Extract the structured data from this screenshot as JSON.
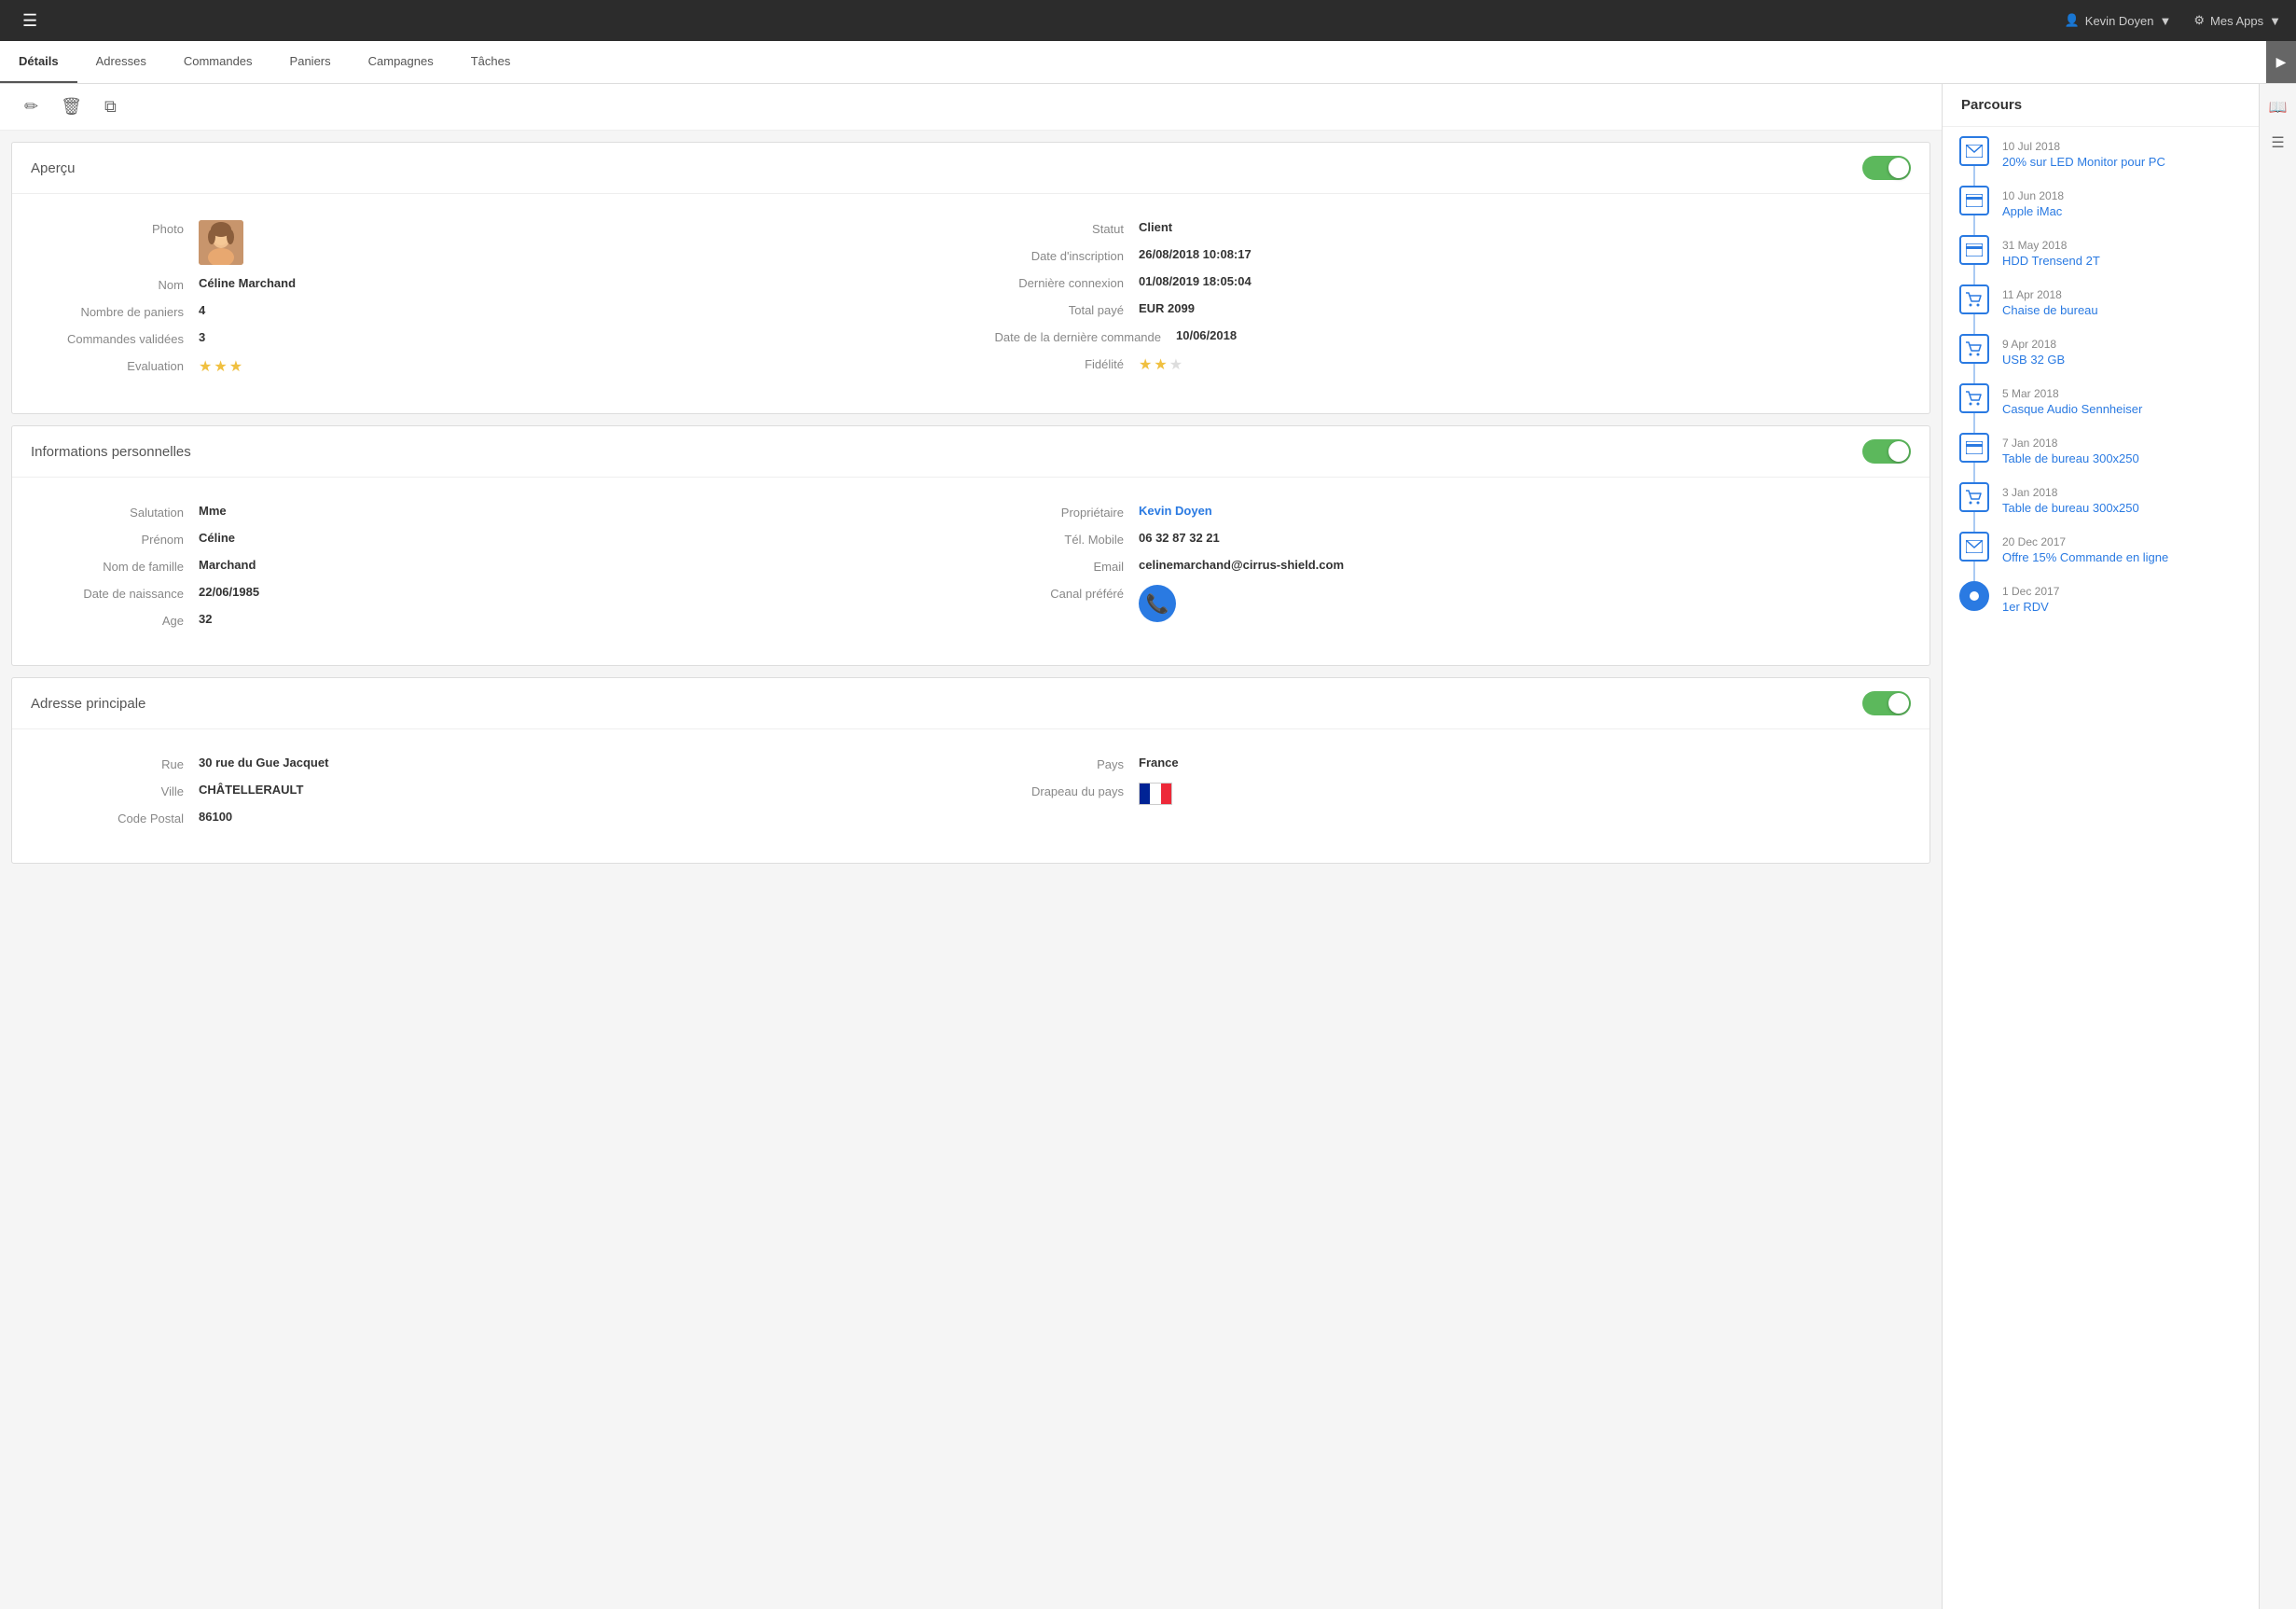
{
  "header": {
    "hamburger_label": "☰",
    "user_icon": "👤",
    "user_name": "Kevin Doyen",
    "user_chevron": "▼",
    "apps_icon": "⚙",
    "apps_label": "Mes Apps",
    "apps_chevron": "▼"
  },
  "tabs": {
    "items": [
      {
        "label": "Détails",
        "active": true
      },
      {
        "label": "Adresses",
        "active": false
      },
      {
        "label": "Commandes",
        "active": false
      },
      {
        "label": "Paniers",
        "active": false
      },
      {
        "label": "Campagnes",
        "active": false
      },
      {
        "label": "Tâches",
        "active": false
      }
    ],
    "arrow": "▶"
  },
  "toolbar": {
    "edit_icon": "✏",
    "delete_icon": "🗑",
    "copy_icon": "⧉"
  },
  "apercu": {
    "title": "Aperçu",
    "fields_left": {
      "photo_label": "Photo",
      "nom_label": "Nom",
      "nom_value": "Céline Marchand",
      "paniers_label": "Nombre de paniers",
      "paniers_value": "4",
      "commandes_label": "Commandes validées",
      "commandes_value": "3",
      "evaluation_label": "Evaluation"
    },
    "fields_right": {
      "statut_label": "Statut",
      "statut_value": "Client",
      "inscription_label": "Date d'inscription",
      "inscription_value": "26/08/2018 10:08:17",
      "connexion_label": "Dernière connexion",
      "connexion_value": "01/08/2019 18:05:04",
      "total_label": "Total payé",
      "total_value": "EUR 2099",
      "date_commande_label": "Date de la dernière commande",
      "date_commande_value": "10/06/2018",
      "fidelite_label": "Fidélité"
    }
  },
  "infos_perso": {
    "title": "Informations personnelles",
    "fields_left": {
      "salutation_label": "Salutation",
      "salutation_value": "Mme",
      "prenom_label": "Prénom",
      "prenom_value": "Céline",
      "nom_label": "Nom de famille",
      "nom_value": "Marchand",
      "naissance_label": "Date de naissance",
      "naissance_value": "22/06/1985",
      "age_label": "Age",
      "age_value": "32"
    },
    "fields_right": {
      "proprietaire_label": "Propriétaire",
      "proprietaire_value": "Kevin Doyen",
      "mobile_label": "Tél. Mobile",
      "mobile_value": "06 32 87 32 21",
      "email_label": "Email",
      "email_value": "celinemarchand@cirrus-shield.com",
      "canal_label": "Canal préféré"
    }
  },
  "adresse": {
    "title": "Adresse principale",
    "fields_left": {
      "rue_label": "Rue",
      "rue_value": "30 rue du Gue Jacquet",
      "ville_label": "Ville",
      "ville_value": "CHÂTELLERAULT",
      "code_label": "Code Postal",
      "code_value": "86100"
    },
    "fields_right": {
      "pays_label": "Pays",
      "pays_value": "France",
      "drapeau_label": "Drapeau du pays"
    }
  },
  "parcours": {
    "title": "Parcours",
    "items": [
      {
        "date": "10 Jul 2018",
        "label": "20% sur LED Monitor pour PC",
        "icon_type": "email"
      },
      {
        "date": "10 Jun 2018",
        "label": "Apple iMac",
        "icon_type": "card"
      },
      {
        "date": "31 May 2018",
        "label": "HDD Trensend 2T",
        "icon_type": "card"
      },
      {
        "date": "11 Apr 2018",
        "label": "Chaise de bureau",
        "icon_type": "cart"
      },
      {
        "date": "9 Apr 2018",
        "label": "USB 32 GB",
        "icon_type": "cart"
      },
      {
        "date": "5 Mar 2018",
        "label": "Casque Audio Sennheiser",
        "icon_type": "cart"
      },
      {
        "date": "7 Jan 2018",
        "label": "Table de bureau 300x250",
        "icon_type": "card"
      },
      {
        "date": "3 Jan 2018",
        "label": "Table de bureau 300x250",
        "icon_type": "cart"
      },
      {
        "date": "20 Dec 2017",
        "label": "Offre 15% Commande en ligne",
        "icon_type": "email"
      },
      {
        "date": "1 Dec 2017",
        "label": "1er RDV",
        "icon_type": "circle"
      }
    ]
  }
}
